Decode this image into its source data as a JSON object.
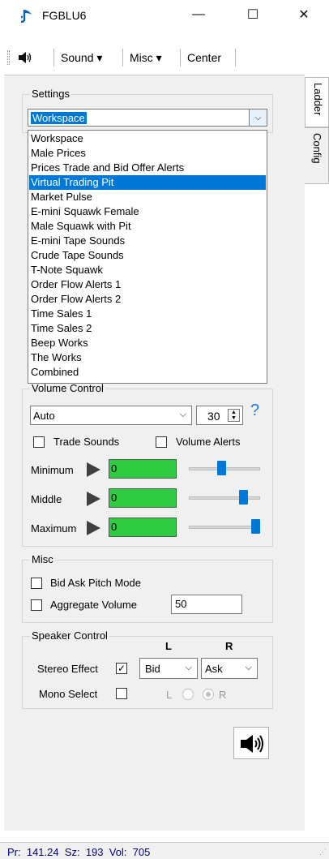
{
  "window": {
    "title": "FGBLU6",
    "minimize_glyph": "—",
    "maximize_glyph": "☐",
    "close_glyph": "✕"
  },
  "toolbar": {
    "sound_menu": "Sound ▾",
    "misc_menu": "Misc ▾",
    "center_button": "Center"
  },
  "side_tabs": [
    "Ladder",
    "Config"
  ],
  "settings": {
    "legend": "Settings",
    "selected": "Workspace",
    "options": [
      "Workspace",
      "Male Prices",
      "Prices Trade and Bid Offer Alerts",
      "Virtual Trading Pit",
      "Market Pulse",
      "E-mini Squawk Female",
      "Male Squawk with Pit",
      "E-mini Tape Sounds",
      "Crude Tape Sounds",
      "T-Note Squawk",
      "Order Flow Alerts 1",
      "Order Flow Alerts 2",
      "Time Sales 1",
      "Time Sales 2",
      "Beep Works",
      "The Works",
      "Combined"
    ],
    "highlighted": "Virtual Trading Pit"
  },
  "volume_control": {
    "legend": "Volume Control",
    "mode": "Auto",
    "spinner_value": "30",
    "help": "?",
    "trade_sounds_label": "Trade Sounds",
    "trade_sounds_checked": false,
    "volume_alerts_label": "Volume Alerts",
    "volume_alerts_checked": false,
    "rows": [
      {
        "label": "Minimum",
        "value": "0",
        "slider_level": 0.45
      },
      {
        "label": "Middle",
        "value": "0",
        "slider_level": 0.8
      },
      {
        "label": "Maximum",
        "value": "0",
        "slider_level": 1.0
      }
    ]
  },
  "misc": {
    "legend": "Misc",
    "bid_ask_label": "Bid Ask Pitch Mode",
    "bid_ask_checked": false,
    "aggregate_label": "Aggregate Volume",
    "aggregate_checked": false,
    "aggregate_value": "50"
  },
  "speaker": {
    "legend": "Speaker Control",
    "col_l": "L",
    "col_r": "R",
    "stereo_label": "Stereo Effect",
    "stereo_checked": true,
    "left_select": "Bid",
    "right_select": "Ask",
    "mono_label": "Mono Select",
    "mono_checked": false,
    "mono_l": "L",
    "mono_r": "R"
  },
  "status": {
    "text": "Pr:  141.24  Sz:  193  Vol:  705"
  },
  "icons": {
    "app": "music-note-icon",
    "speaker": "speaker-icon",
    "accent": "#0078d7",
    "meter_green": "#2ecc40"
  }
}
